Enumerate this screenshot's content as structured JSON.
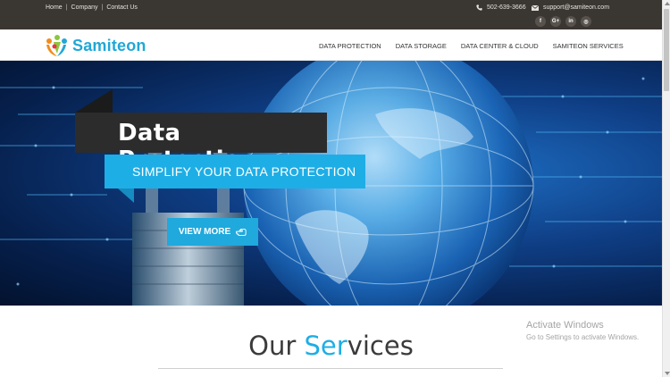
{
  "topbar": {
    "links": [
      "Home",
      "Company",
      "Contact Us"
    ],
    "separator": "|",
    "phone": "502-639-3666",
    "email": "support@samiteon.com",
    "socials": [
      {
        "icon": "facebook-icon",
        "glyph": "f"
      },
      {
        "icon": "google-plus-icon",
        "glyph": "G+"
      },
      {
        "icon": "linkedin-icon",
        "glyph": "in"
      },
      {
        "icon": "instagram-icon",
        "glyph": "◎"
      }
    ]
  },
  "header": {
    "logo_text": "Samiteon",
    "nav": [
      "DATA PROTECTION",
      "DATA STORAGE",
      "DATA CENTER & CLOUD",
      "SAMITEON SERVICES"
    ]
  },
  "hero": {
    "title": "Data Protection",
    "subtitle": "SIMPLIFY YOUR DATA PROTECTION",
    "button_label": "VIEW MORE"
  },
  "services": {
    "title_start": "Our ",
    "title_highlight": "Ser",
    "title_end": "vices"
  },
  "windows_watermark": {
    "line1": "Activate Windows",
    "line2": "Go to Settings to activate Windows."
  },
  "colors": {
    "accent": "#1eaee6",
    "topbar": "#3a3631",
    "title_box": "#2c2c2c"
  }
}
